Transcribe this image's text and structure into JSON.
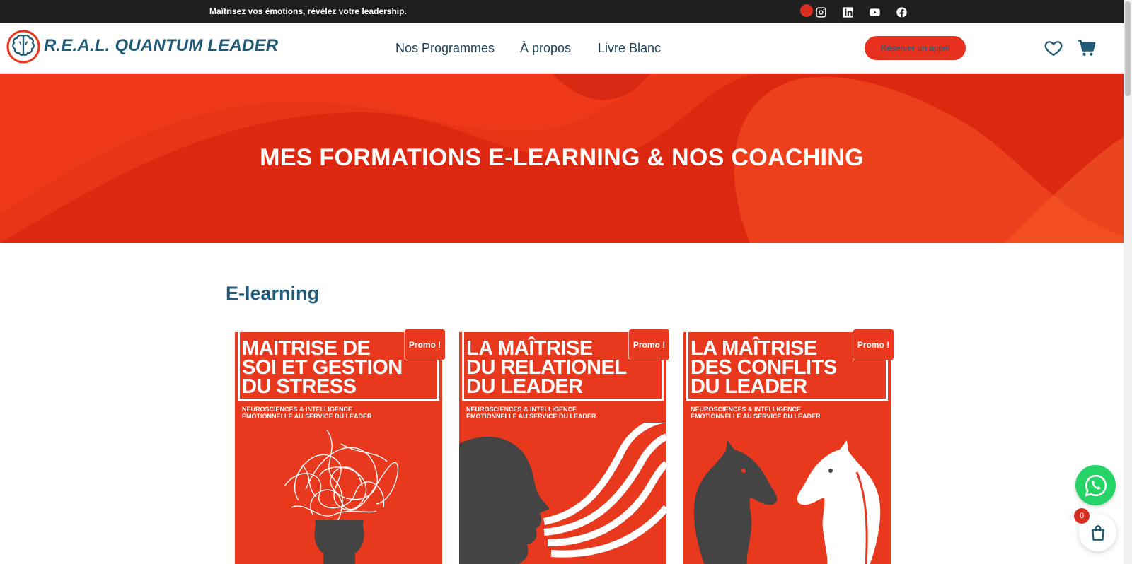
{
  "topbar": {
    "tagline": "Maîtrisez vos émotions, révélez votre leadership.",
    "social_icons": [
      "instagram-icon",
      "linkedin-icon",
      "youtube-icon",
      "facebook-icon"
    ]
  },
  "header": {
    "brand": "R.E.A.L. QUANTUM LEADER",
    "nav": [
      "Nos Programmes",
      "À propos",
      "Livre Blanc"
    ],
    "cta_label": "Réserver un appel",
    "icons": [
      "heart-icon",
      "cart-icon"
    ]
  },
  "hero": {
    "title": "MES FORMATIONS E-LEARNING & NOS COACHING"
  },
  "elearning": {
    "section_title": "E-learning",
    "products": [
      {
        "cover_title": "MAITRISE DE SOI ET GESTION DU STRESS",
        "cover_title_lines": [
          "MAITRISE DE",
          "SOI ET GESTION",
          "DU STRESS"
        ],
        "cover_subtitle_lines": [
          "NEUROSCIENCES & INTELLIGENCE",
          "ÉMOTIONNELLE AU SERVICE DU LEADER"
        ],
        "badge": "Promo !"
      },
      {
        "cover_title": "LA MAÎTRISE DU RELATIONEL DU LEADER",
        "cover_title_lines": [
          "LA MAÎTRISE",
          "DU RELATIONEL",
          "DU LEADER"
        ],
        "cover_subtitle_lines": [
          "NEUROSCIENCES & INTELLIGENCE",
          "ÉMOTIONNELLE AU SERVICE DU LEADER"
        ],
        "badge": "Promo !"
      },
      {
        "cover_title": "LA MAÎTRISE DES CONFLITS DU LEADER",
        "cover_title_lines": [
          "LA MAÎTRISE",
          "DES CONFLITS",
          "DU LEADER"
        ],
        "cover_subtitle_lines": [
          "NEUROSCIENCES & INTELLIGENCE",
          "ÉMOTIONNELLE AU SERVICE DU LEADER"
        ],
        "badge": "Promo !"
      }
    ]
  },
  "floating": {
    "cart_count": "0",
    "icons": [
      "whatsapp-icon",
      "shopping-bag-icon"
    ]
  },
  "colors": {
    "brand_red": "#e8391f",
    "brand_blue": "#1f5a78",
    "topbar_bg": "#1f1f1f",
    "whatsapp_green": "#25d366"
  }
}
